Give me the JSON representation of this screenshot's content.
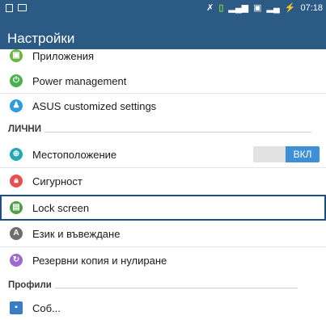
{
  "status_bar": {
    "time": "07:18",
    "icons": [
      "sd-card-icon",
      "photo-icon",
      "no-sync-icon",
      "sim-icon",
      "signal-icon",
      "data-icon",
      "signal2-icon",
      "battery-charging-icon"
    ]
  },
  "app_bar": {
    "title": "Настройки"
  },
  "items": [
    {
      "label": "Приложения",
      "icon": "apps-icon",
      "color": "#6cb543"
    },
    {
      "label": "Power management",
      "icon": "power-icon",
      "color": "#4caf50"
    },
    {
      "label": "ASUS customized settings",
      "icon": "asus-icon",
      "color": "#2d9be0"
    },
    {
      "label": "Местоположение",
      "icon": "location-icon",
      "color": "#22a9b6"
    },
    {
      "label": "Сигурност",
      "icon": "lock-icon",
      "color": "#e84f4f"
    },
    {
      "label": "Lock screen",
      "icon": "lockscreen-icon",
      "color": "#4f9f43"
    },
    {
      "label": "Език и въвеждане",
      "icon": "language-icon",
      "color": "#6e6e6e"
    },
    {
      "label": "Резервни копия и нулиране",
      "icon": "backup-icon",
      "color": "#9c6ad1"
    },
    {
      "label": "Соб...",
      "icon": "profile-icon",
      "color": "#3b7dc4"
    }
  ],
  "sections": {
    "personal": "ЛИЧНИ",
    "profiles": "Профили"
  },
  "location_toggle": {
    "label": "ВКЛ",
    "state": "on",
    "accent": "#3f8fd6"
  },
  "colors": {
    "brand": "#2b5a84",
    "selection": "#1f4e86"
  }
}
